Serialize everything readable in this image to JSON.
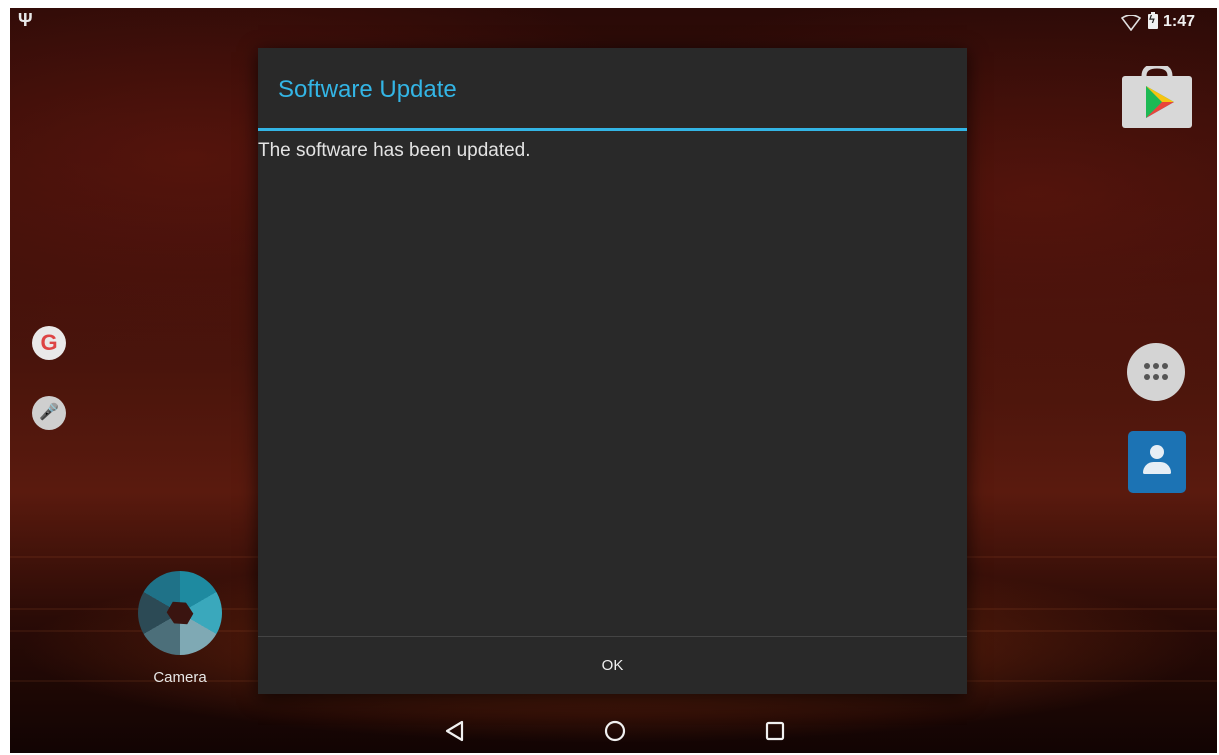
{
  "status_bar": {
    "time": "1:47",
    "usb_icon": "usb-icon",
    "wifi_icon": "wifi-outline-icon",
    "battery_icon": "battery-charging-icon"
  },
  "home": {
    "camera_label": "Camera",
    "google_glyph": "G",
    "icons": [
      "play-store-icon",
      "google-search-icon",
      "mic-icon",
      "app-drawer-icon",
      "contacts-icon",
      "camera-icon"
    ]
  },
  "dialog": {
    "title": "Software Update",
    "message": "The software has been updated.",
    "ok_label": "OK",
    "accent_color": "#33b5e5"
  },
  "nav": {
    "icons": [
      "back-icon",
      "home-icon",
      "recents-icon"
    ]
  }
}
